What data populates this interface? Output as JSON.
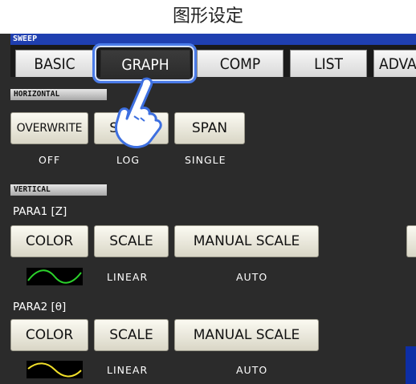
{
  "caption": "图形设定",
  "mode_label": "SWEEP",
  "tabs": [
    {
      "label": "BASIC",
      "active": false
    },
    {
      "label": "GRAPH",
      "active": true
    },
    {
      "label": "COMP",
      "active": false
    },
    {
      "label": "LIST",
      "active": false
    },
    {
      "label": "ADVA",
      "active": false
    }
  ],
  "horizontal": {
    "section": "HORIZONTAL",
    "overwrite": {
      "label": "OVERWRITE",
      "value": "OFF"
    },
    "scale": {
      "label": "SCALE",
      "value": "LOG"
    },
    "span": {
      "label": "SPAN",
      "value": "SINGLE"
    }
  },
  "vertical": {
    "section": "VERTICAL",
    "para1": {
      "label": "PARA1 [Z]",
      "color_btn": "COLOR",
      "scale_btn": "SCALE",
      "manual_btn": "MANUAL SCALE",
      "scale_value": "LINEAR",
      "manual_value": "AUTO",
      "trace_color": "#2bd12b"
    },
    "para2": {
      "label": "PARA2 [θ]",
      "color_btn": "COLOR",
      "scale_btn": "SCALE",
      "manual_btn": "MANUAL SCALE",
      "scale_value": "LINEAR",
      "manual_value": "AUTO",
      "trace_color": "#f2e02a"
    }
  },
  "colors": {
    "screen_bg": "#2b2b2b",
    "mode_strip": "#1f3fb0",
    "highlight": "#4a7be8"
  }
}
